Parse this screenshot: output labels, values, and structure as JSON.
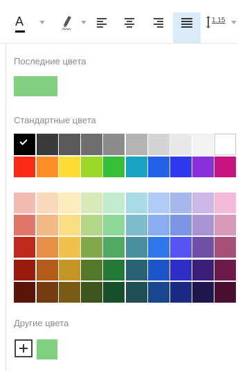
{
  "toolbar": {
    "font_color_letter": "A",
    "font_color_underline": "#000000",
    "line_spacing_value": "1.15",
    "icons": [
      "font-color-icon",
      "highlight-icon",
      "align-left-icon",
      "align-center-icon",
      "align-right-icon",
      "align-justify-icon",
      "line-spacing-icon"
    ],
    "active_button": "align-justify"
  },
  "recent": {
    "label": "Последние цвета",
    "colors": [
      "#7fd17f"
    ]
  },
  "standard": {
    "label": "Стандартные цвета",
    "selected_color": "#000000",
    "row1": [
      "#000000",
      "#3a3a3a",
      "#595959",
      "#6f6f6f",
      "#8c8c8c",
      "#b3b3b3",
      "#d4d4d4",
      "#e8e8e8",
      "#f2f2f2",
      "#ffffff"
    ],
    "row2": [
      "#fb2b17",
      "#fd8e28",
      "#fedc33",
      "#9cd826",
      "#36c03a",
      "#19a4c3",
      "#2562ec",
      "#2f39f0",
      "#8a2fdc",
      "#c61380"
    ],
    "palette": [
      [
        "#f2bcb3",
        "#fbd8b8",
        "#fcebbb",
        "#d8e8b8",
        "#c0ebcd",
        "#a9dbe6",
        "#afcbf6",
        "#a7b8ee",
        "#cbb8e8",
        "#f4b9d9"
      ],
      [
        "#e1776a",
        "#f1b986",
        "#fbdd86",
        "#b3d689",
        "#8ed99a",
        "#7fbccb",
        "#89acf2",
        "#7b96e4",
        "#a995d6",
        "#d899b9"
      ],
      [
        "#c02a1b",
        "#e58f47",
        "#f0c14b",
        "#84a84c",
        "#50aa62",
        "#4a8f9f",
        "#2f78ec",
        "#5455f2",
        "#6f4fa8",
        "#a84f78"
      ],
      [
        "#9a1c0f",
        "#b15a1a",
        "#c39426",
        "#55792a",
        "#237837",
        "#2a6373",
        "#1d55c6",
        "#2d2ec8",
        "#3a1f7a",
        "#6d1a4a"
      ],
      [
        "#5a1408",
        "#743b10",
        "#7a5c14",
        "#3d541c",
        "#18502a",
        "#204d57",
        "#19478f",
        "#1c2a86",
        "#1f1850",
        "#4a1033"
      ]
    ]
  },
  "custom": {
    "label": "Другие цвета",
    "colors": [
      "#7fd17f"
    ]
  }
}
